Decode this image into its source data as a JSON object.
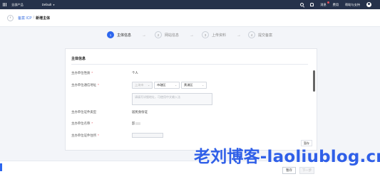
{
  "topnav": {
    "product_menu": "全部产品",
    "region": "Default",
    "messages": "消息",
    "cost": "费用",
    "help": "帮助与支持"
  },
  "breadcrumb": {
    "parent": "备案 ICP",
    "separator": "/",
    "current": "新增主体"
  },
  "steps": [
    {
      "num": "1",
      "label": "主体信息"
    },
    {
      "num": "2",
      "label": "网站信息"
    },
    {
      "num": "3",
      "label": "上传资料"
    },
    {
      "num": "4",
      "label": "提交备案"
    }
  ],
  "step_arrow": "→",
  "form": {
    "section_title": "主体信息",
    "fields": {
      "unit_nature": {
        "label": "主办单位性质",
        "required": "*",
        "value": "个人"
      },
      "unit_address": {
        "label": "主办单位通信地址",
        "required": "*",
        "province": "上海市",
        "city": "市辖区",
        "district": "黄浦区"
      },
      "address_placeholder": "请填写详细地址，可使用中文输入法",
      "id_type": {
        "label": "主办单位证件类型",
        "value": "居民身份证"
      },
      "unit_name": {
        "label": "主办单位名称",
        "required": "*",
        "value": "彭"
      },
      "id_address": {
        "label": "主办单位证件住所",
        "required": "*"
      }
    },
    "temp_save": "暂存"
  },
  "bottom": {
    "save": "暂存",
    "next": "下一步"
  },
  "watermark": "老刘博客-laoliublog.cn",
  "colors": {
    "topnav_bg": "#26324b",
    "primary": "#2c66ee",
    "required": "#e34d59",
    "watermark": "#2f5fe8"
  }
}
